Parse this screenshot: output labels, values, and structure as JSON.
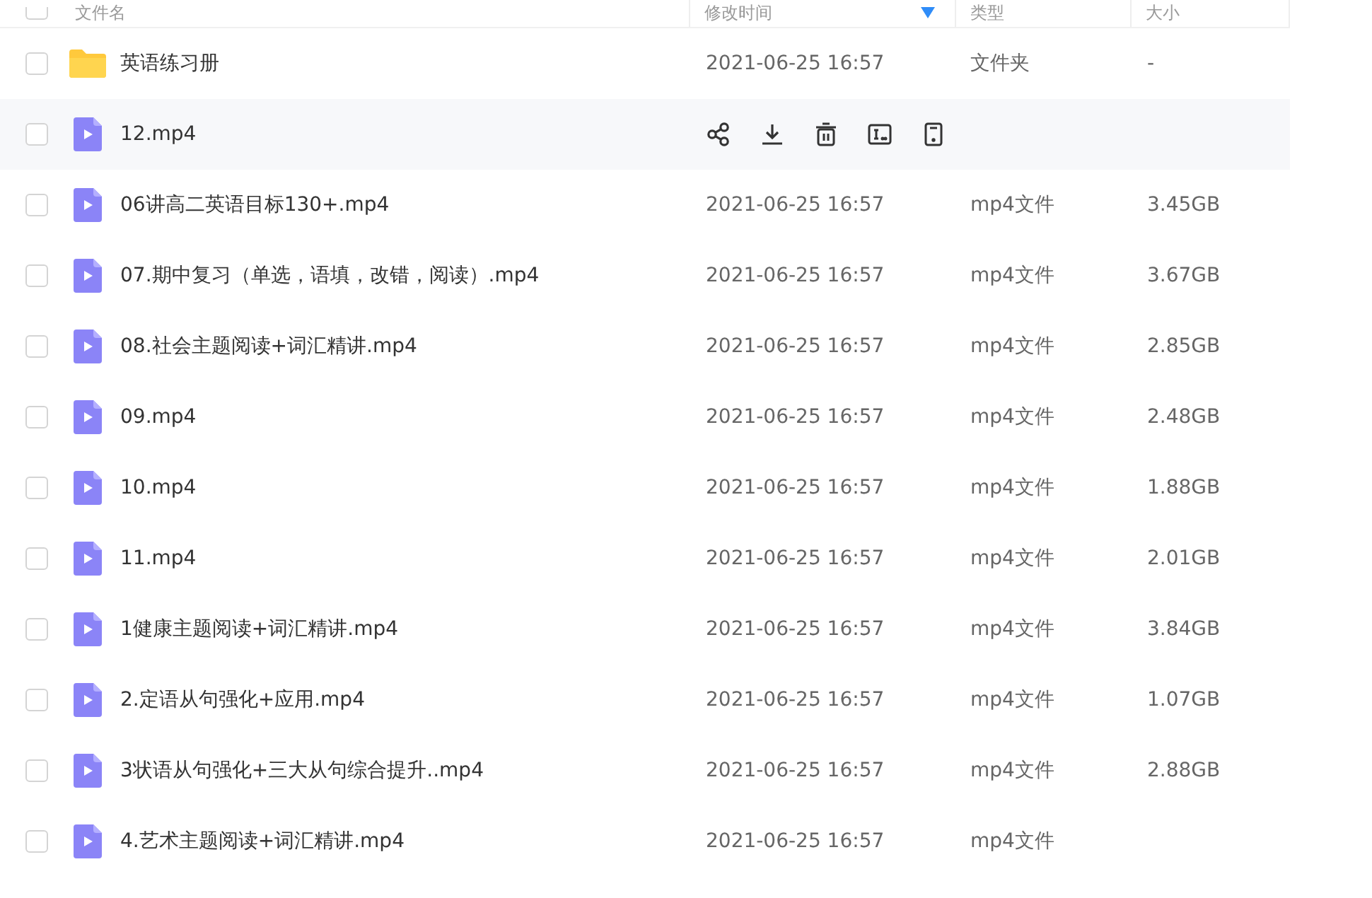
{
  "header": {
    "checked": false,
    "columns": [
      {
        "label": "文件名",
        "sorted": false
      },
      {
        "label": "修改时间",
        "sorted": true
      },
      {
        "label": "类型",
        "sorted": false
      },
      {
        "label": "大小",
        "sorted": false
      }
    ]
  },
  "rows": [
    {
      "kind": "folder",
      "name": "英语练习册",
      "modified": "2021-06-25 16:57",
      "type": "文件夹",
      "size": "-",
      "checked": false,
      "hovered": false
    },
    {
      "kind": "video",
      "name": "12.mp4",
      "checked": false,
      "hovered": true
    },
    {
      "kind": "video",
      "name": "06讲高二英语目标130+.mp4",
      "modified": "2021-06-25 16:57",
      "type": "mp4文件",
      "size": "3.45GB",
      "checked": false,
      "hovered": false
    },
    {
      "kind": "video",
      "name": "07.期中复习（单选，语填，改错，阅读）.mp4",
      "modified": "2021-06-25 16:57",
      "type": "mp4文件",
      "size": "3.67GB",
      "checked": false,
      "hovered": false
    },
    {
      "kind": "video",
      "name": "08.社会主题阅读+词汇精讲.mp4",
      "modified": "2021-06-25 16:57",
      "type": "mp4文件",
      "size": "2.85GB",
      "checked": false,
      "hovered": false
    },
    {
      "kind": "video",
      "name": "09.mp4",
      "modified": "2021-06-25 16:57",
      "type": "mp4文件",
      "size": "2.48GB",
      "checked": false,
      "hovered": false
    },
    {
      "kind": "video",
      "name": "10.mp4",
      "modified": "2021-06-25 16:57",
      "type": "mp4文件",
      "size": "1.88GB",
      "checked": false,
      "hovered": false
    },
    {
      "kind": "video",
      "name": "11.mp4",
      "modified": "2021-06-25 16:57",
      "type": "mp4文件",
      "size": "2.01GB",
      "checked": false,
      "hovered": false
    },
    {
      "kind": "video",
      "name": "1健康主题阅读+词汇精讲.mp4",
      "modified": "2021-06-25 16:57",
      "type": "mp4文件",
      "size": "3.84GB",
      "checked": false,
      "hovered": false
    },
    {
      "kind": "video",
      "name": "2.定语从句强化+应用.mp4",
      "modified": "2021-06-25 16:57",
      "type": "mp4文件",
      "size": "1.07GB",
      "checked": false,
      "hovered": false
    },
    {
      "kind": "video",
      "name": "3状语从句强化+三大从句综合提升..mp4",
      "modified": "2021-06-25 16:57",
      "type": "mp4文件",
      "size": "2.88GB",
      "checked": false,
      "hovered": false
    },
    {
      "kind": "video",
      "name": "4.艺术主题阅读+词汇精讲.mp4",
      "modified": "2021-06-25 16:57",
      "type": "mp4文件",
      "checked": false,
      "hovered": false
    }
  ]
}
